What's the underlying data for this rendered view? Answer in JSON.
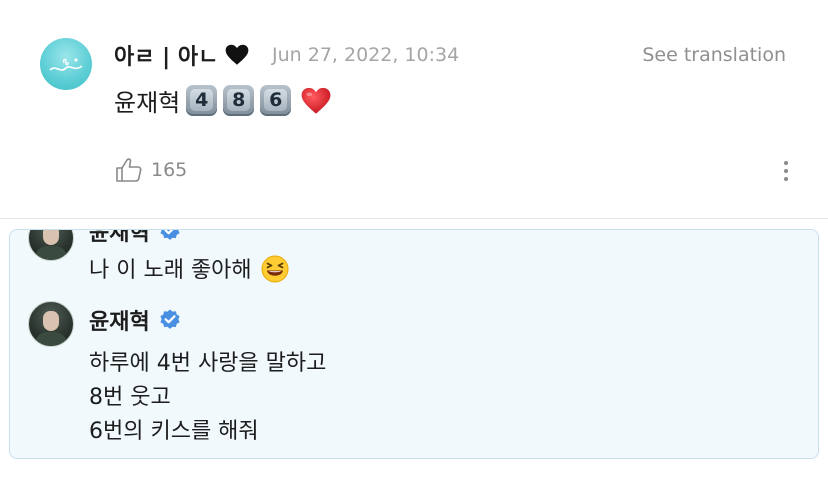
{
  "post": {
    "author": "아ㄹ | 아ㄴ",
    "timestamp": "Jun 27, 2022, 10:34",
    "translate_label": "See translation",
    "content_text": "윤재혁",
    "keycaps": [
      "4",
      "8",
      "6"
    ],
    "likes_count": "165",
    "icons": {
      "author_emoji": "black-heart-icon",
      "content_emoji": "red-heart-icon",
      "like": "thumbs-up-icon",
      "more": "more-vertical-icon"
    }
  },
  "thread": {
    "messages": [
      {
        "name": "윤재혁",
        "verified": true,
        "lines": [
          "나 이 노래 좋아해"
        ],
        "emoji": "grinning-squinting-face-icon"
      },
      {
        "name": "윤재혁",
        "verified": true,
        "lines": [
          "하루에 4번 사랑을 말하고",
          "8번 웃고",
          "6번의 키스를 해줘"
        ]
      }
    ]
  },
  "colors": {
    "card_background": "#f1f9fd",
    "card_border": "#c6e2ee",
    "verified_blue": "#4a90e2",
    "heart_red": "#e0262e",
    "muted_text": "#a5a5a5"
  }
}
